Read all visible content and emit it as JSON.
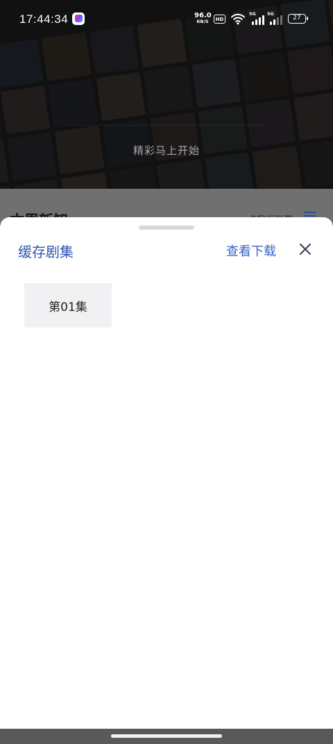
{
  "status_bar": {
    "time": "17:44:34",
    "net_speed_value": "96.0",
    "net_speed_unit": "KB/S",
    "hd_label": "HD",
    "sim1_label": "5G",
    "sim2_label": "5G",
    "battery": "27"
  },
  "player": {
    "hint": "精彩马上开始"
  },
  "section_peek": {
    "title": "本周新知",
    "link": "点我发弹幕"
  },
  "sheet": {
    "title": "缓存剧集",
    "view_downloads": "查看下载",
    "episodes": [
      {
        "label": "第01集"
      }
    ]
  },
  "colors": {
    "accent": "#3a63c6",
    "title_blue": "#2f55b0",
    "episode_bg": "#f1f1f3"
  },
  "icons": [
    "wifi-icon",
    "signal-icon",
    "battery-icon",
    "close-icon",
    "list-icon",
    "app-icon"
  ]
}
